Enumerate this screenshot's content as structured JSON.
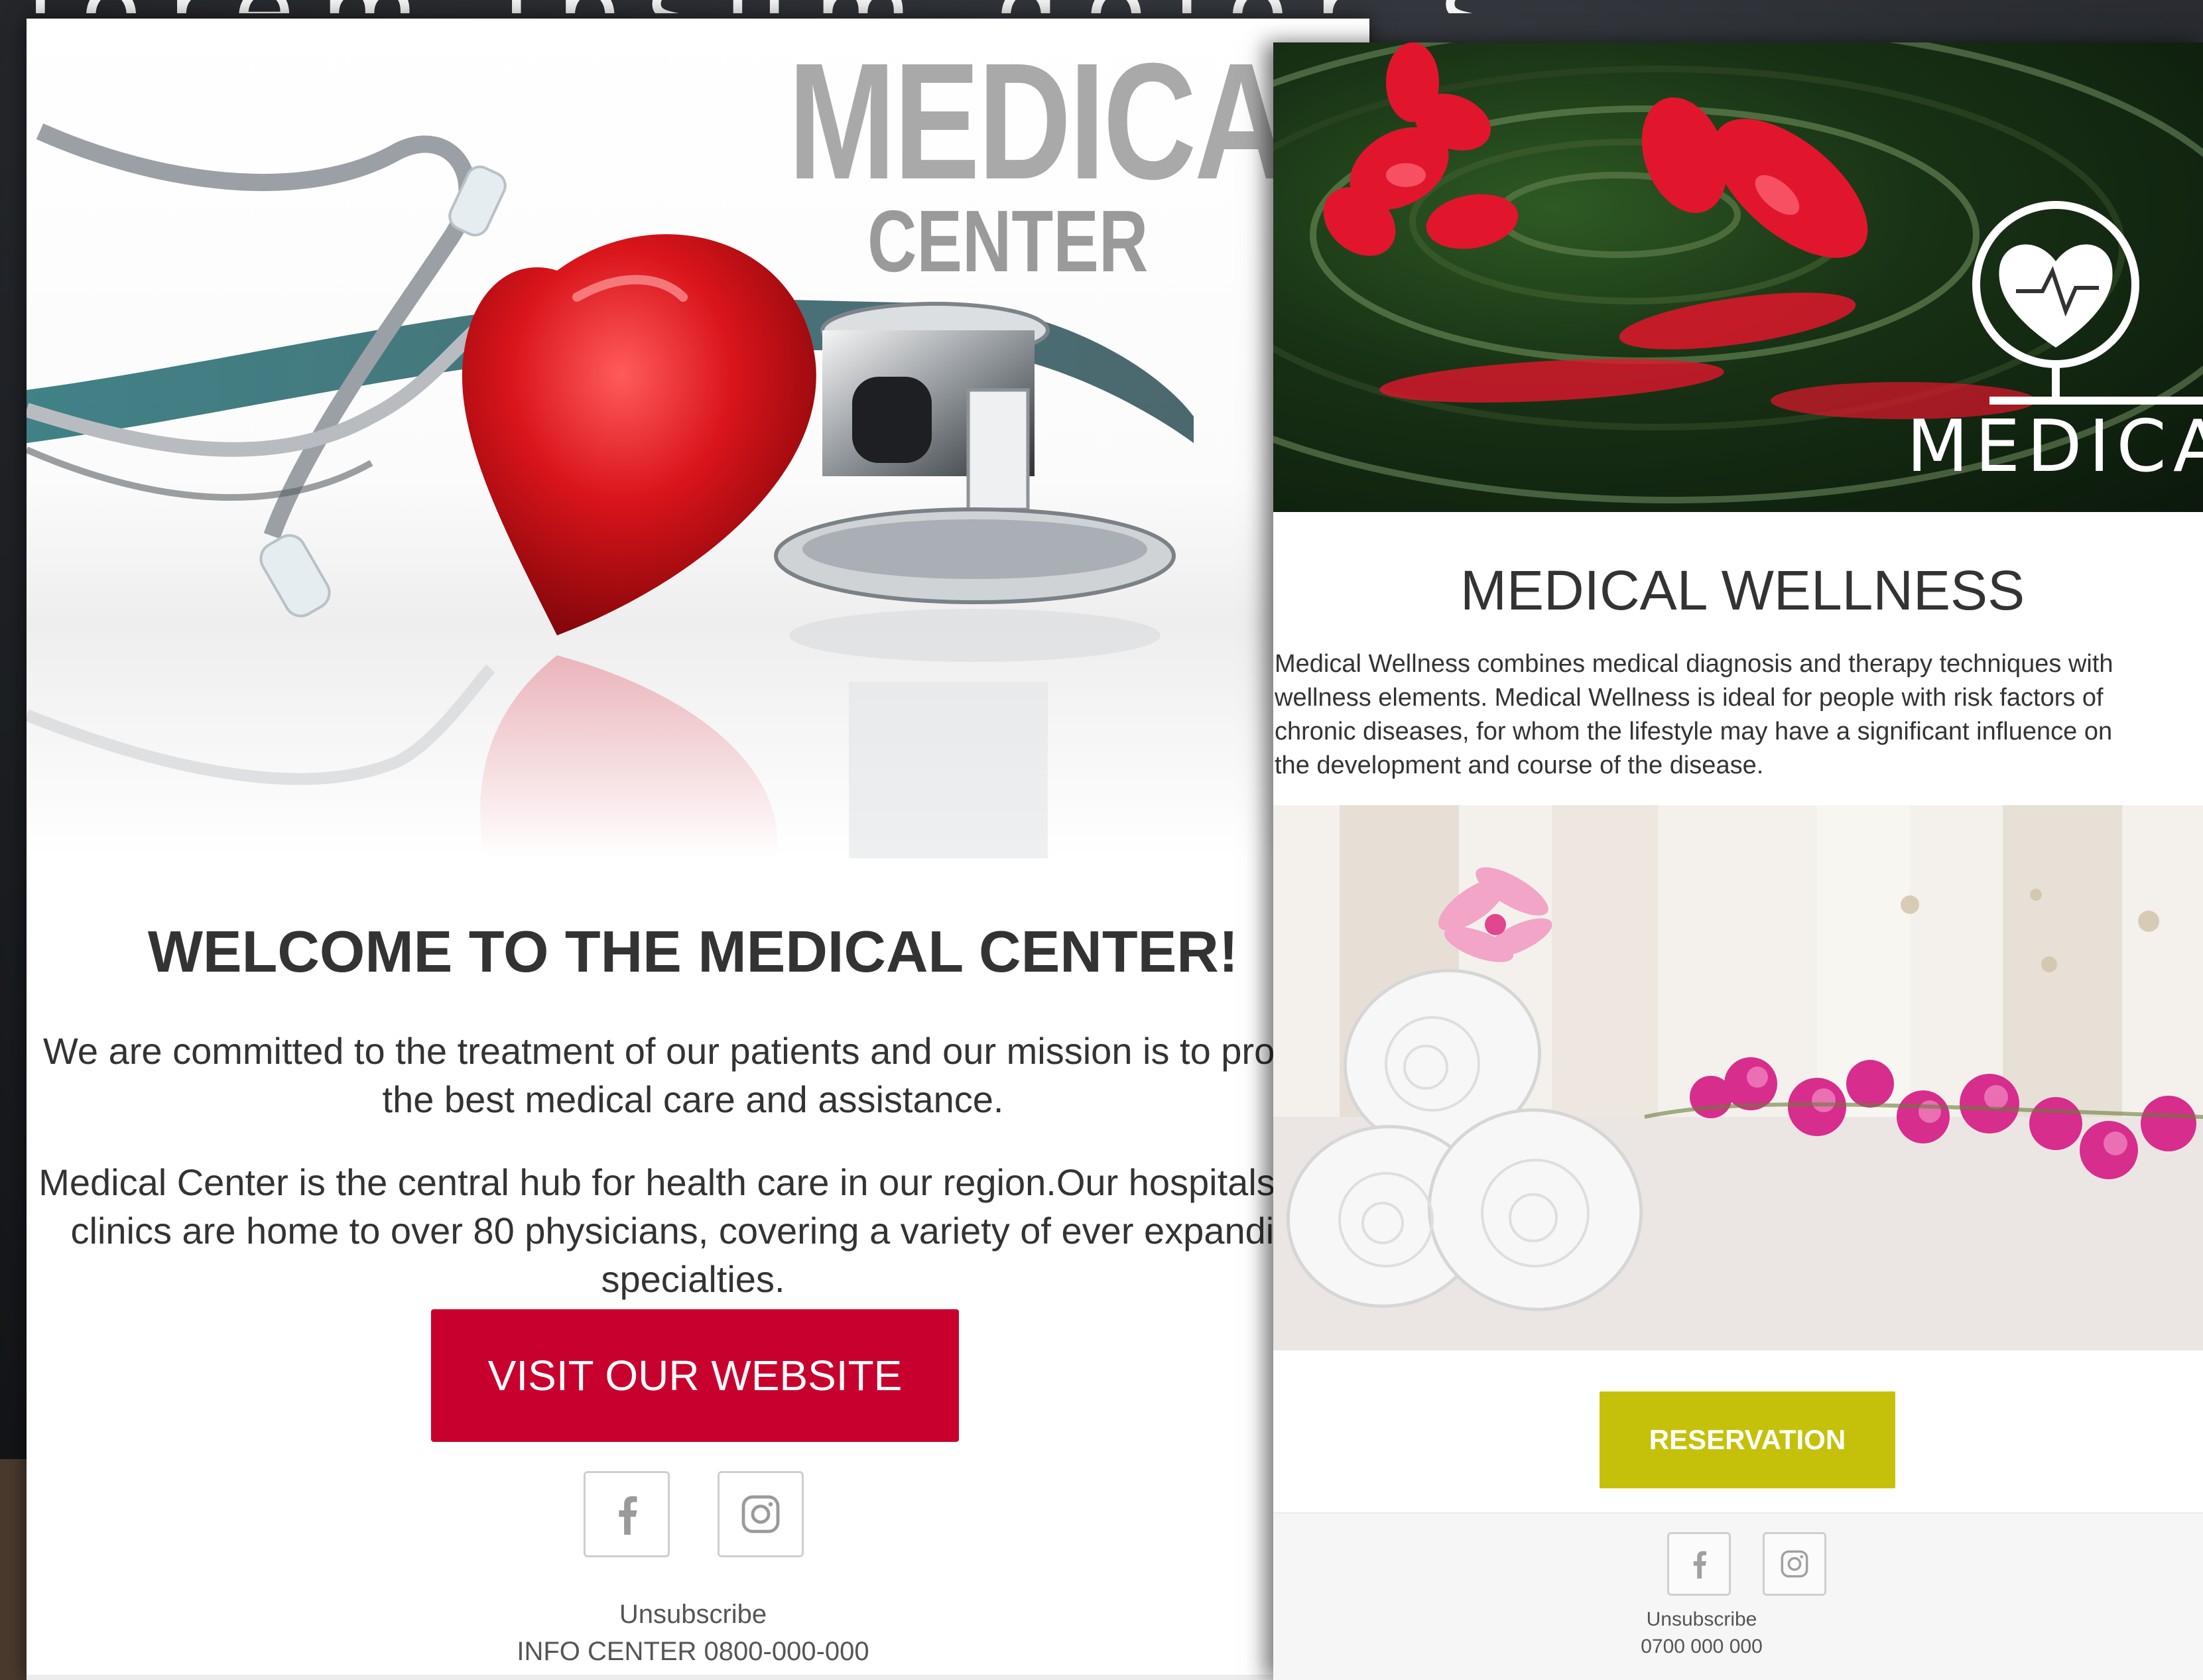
{
  "background": {
    "top_text": "lorem ipsum dolor sit amet"
  },
  "card1": {
    "brand_line1": "MEDICAL",
    "brand_line2": "CENTER",
    "title": "WELCOME TO THE MEDICAL CENTER!",
    "paragraph1": "We are committed to the treatment of our patients and our mission is to provide the best medical care and assistance.",
    "paragraph2": "Medical Center is the central hub for health care in our region.Our hospitals and clinics are home to over 80 physicians, covering a variety of ever expanding specialties.",
    "button_label": "VISIT OUR WEBSITE",
    "button_color": "#c8002d",
    "social": [
      "facebook-icon",
      "instagram-icon"
    ],
    "unsubscribe": "Unsubscribe",
    "info": "INFO CENTER 0800-000-000"
  },
  "card2": {
    "logo_text": "MEDICAL",
    "title": "MEDICAL WELLNESS",
    "body": "Medical Wellness combines medical diagnosis and therapy techniques with\nwellness elements. Medical Wellness is ideal for people with risk factors of\nchronic diseases, for whom the lifestyle may have a significant influence on\nthe development and course of the disease.",
    "button_label": "RESERVATION",
    "button_color": "#c5c10b",
    "social": [
      "facebook-icon",
      "instagram-icon"
    ],
    "unsubscribe": "Unsubscribe",
    "phone": "0700 000 000"
  }
}
